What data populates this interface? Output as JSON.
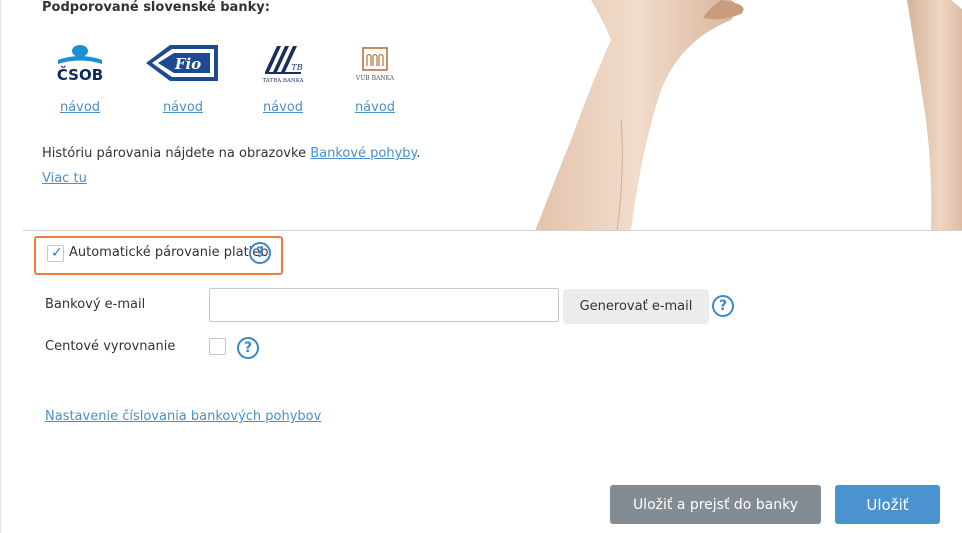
{
  "banks": {
    "title": "Podporované slovenské banky:",
    "items": [
      {
        "logo_text": "ČSOB",
        "link": "návod"
      },
      {
        "logo_text": "Fio",
        "link": "návod"
      },
      {
        "logo_text": "TATRA BANKA",
        "link": "návod"
      },
      {
        "logo_text": "VÚB BANKA",
        "link": "návod"
      }
    ]
  },
  "history": {
    "text": "Históriu párovania nájdete na obrazovke ",
    "link": "Bankové pohyby",
    "suffix": "."
  },
  "more_link": "Viac tu",
  "auto_pairing": {
    "label": "Automatické párovanie platieb",
    "checked": true,
    "help": "?"
  },
  "bank_email": {
    "label": "Bankový e-mail",
    "value": "",
    "generate_label": "Generovať e-mail",
    "help": "?"
  },
  "cent_rounding": {
    "label": "Centové vyrovnanie",
    "checked": false,
    "help": "?"
  },
  "numbering_link": "Nastavenie číslovania bankových pohybov",
  "actions": {
    "save_and_go": "Uložiť a prejsť do banky",
    "save": "Uložiť"
  },
  "colors": {
    "accent": "#4a93d0",
    "highlight": "#f07c3a",
    "link": "#4a90c8",
    "secondary_button": "#848c93"
  }
}
